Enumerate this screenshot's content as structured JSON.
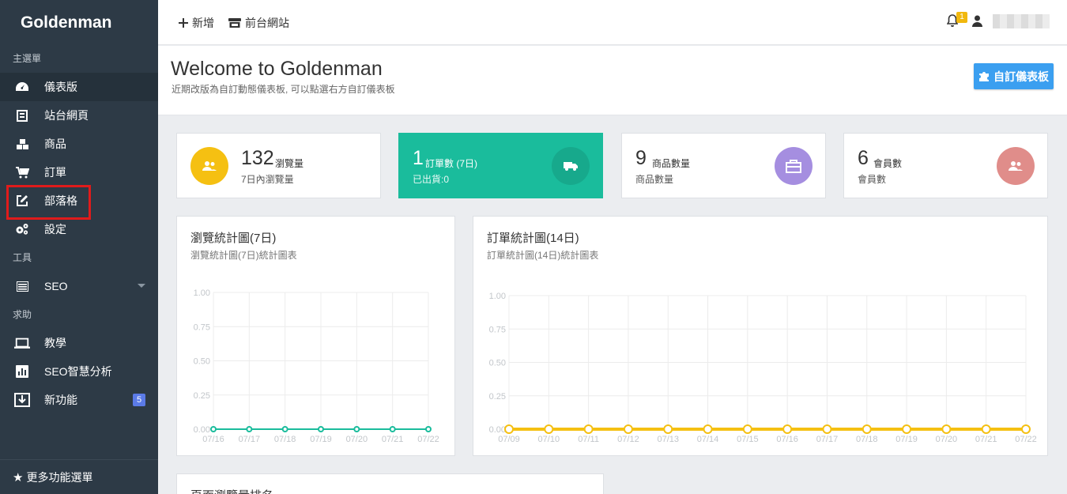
{
  "sidebar": {
    "brand": "Goldenman",
    "sections": [
      "主選單",
      "工具",
      "求助"
    ],
    "items": [
      {
        "label": "儀表版",
        "icon": "dashboard-icon"
      },
      {
        "label": "站台網頁",
        "icon": "page-icon"
      },
      {
        "label": "商品",
        "icon": "cubes-icon"
      },
      {
        "label": "訂單",
        "icon": "cart-icon"
      },
      {
        "label": "部落格",
        "icon": "edit-icon"
      },
      {
        "label": "設定",
        "icon": "gears-icon"
      },
      {
        "label": "SEO",
        "icon": "list-icon"
      },
      {
        "label": "教學",
        "icon": "laptop-icon"
      },
      {
        "label": "SEO智慧分析",
        "icon": "bar-chart-icon"
      },
      {
        "label": "新功能",
        "icon": "download-icon",
        "badge": "5"
      }
    ],
    "more": "更多功能選單"
  },
  "topbar": {
    "add_label": "新增",
    "frontend_label": "前台網站",
    "notification_count": "1"
  },
  "header": {
    "title": "Welcome to Goldenman",
    "subtitle": "近期改版為自訂動態儀表板, 可以點選右方自訂儀表板",
    "custom_button": "自訂儀表板"
  },
  "stats": [
    {
      "value": "132",
      "label": "瀏覽量",
      "sub": "7日內瀏覽量",
      "color": "#f5c012"
    },
    {
      "value": "1",
      "label": "訂單數 (7日)",
      "sub": "已出貨:0",
      "color": "#1abc9c"
    },
    {
      "value": "9",
      "label": "商品數量",
      "sub": "商品數量",
      "color": "#a58ee0"
    },
    {
      "value": "6",
      "label": "會員數",
      "sub": "會員數",
      "color": "#e08d8a"
    }
  ],
  "views_chart": {
    "title": "瀏覽統計圖(7日)",
    "subtitle": "瀏覽統計圖(7日)統計圖表"
  },
  "orders_chart": {
    "title": "訂單統計圖(14日)",
    "subtitle": "訂單統計圖(14日)統計圖表"
  },
  "ranking_panel": {
    "title": "頁面瀏覽量排名"
  },
  "chart_data": [
    {
      "type": "line",
      "title": "瀏覽統計圖(7日)",
      "x": [
        "07/16",
        "07/17",
        "07/18",
        "07/19",
        "07/20",
        "07/21",
        "07/22"
      ],
      "series": [
        {
          "values": [
            0,
            0,
            0,
            0,
            0,
            0,
            0
          ],
          "color": "#1abc9c"
        }
      ],
      "ylim": [
        0,
        1
      ],
      "yticks": [
        "0.00",
        "0.25",
        "0.50",
        "0.75",
        "1.00"
      ],
      "grid": true
    },
    {
      "type": "line",
      "title": "訂單統計圖(14日)",
      "x": [
        "07/09",
        "07/10",
        "07/11",
        "07/12",
        "07/13",
        "07/14",
        "07/15",
        "07/16",
        "07/17",
        "07/18",
        "07/19",
        "07/20",
        "07/21",
        "07/22"
      ],
      "series": [
        {
          "values": [
            0,
            0,
            0,
            0,
            0,
            0,
            0,
            0,
            0,
            0,
            0,
            0,
            0,
            0
          ],
          "color": "#f5c012"
        }
      ],
      "ylim": [
        0,
        1
      ],
      "yticks": [
        "0.00",
        "0.25",
        "0.50",
        "0.75",
        "1.00"
      ],
      "grid": true
    }
  ]
}
